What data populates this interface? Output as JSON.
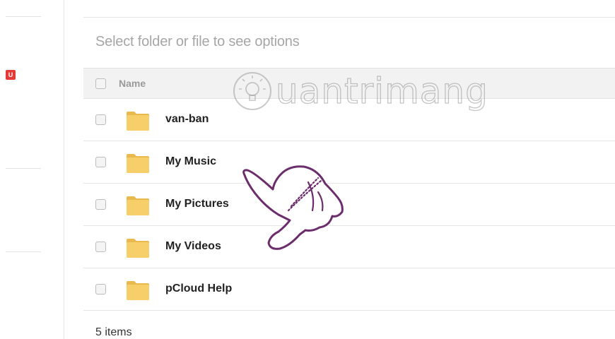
{
  "sidebar": {
    "badge_text": "U"
  },
  "toolbar": {
    "hint": "Select folder or file to see options"
  },
  "list": {
    "header_name": "Name",
    "items": [
      {
        "name": "van-ban",
        "type": "folder"
      },
      {
        "name": "My Music",
        "type": "folder"
      },
      {
        "name": "My Pictures",
        "type": "folder"
      },
      {
        "name": "My Videos",
        "type": "folder"
      },
      {
        "name": "pCloud Help",
        "type": "folder"
      }
    ],
    "count_text": "5 items"
  },
  "watermark": {
    "text": "uantrimang"
  },
  "colors": {
    "folder": "#f6cf6a",
    "folder_tab": "#eab94d",
    "badge": "#e53935",
    "hand": "#6b2d6b"
  }
}
